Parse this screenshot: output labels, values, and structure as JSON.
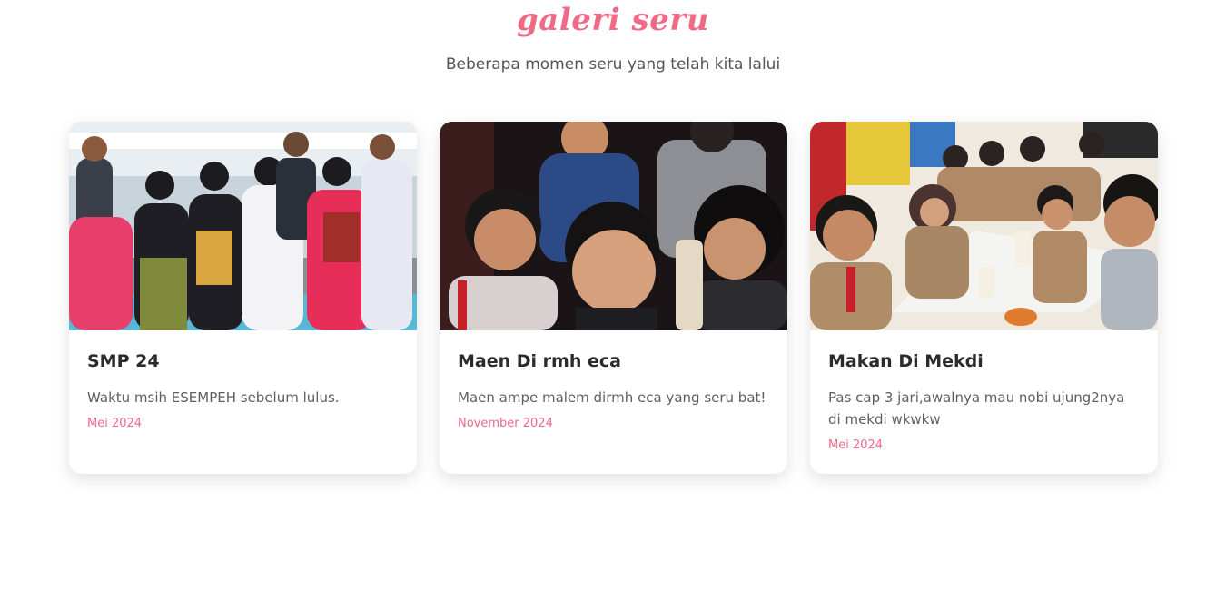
{
  "header": {
    "title": "galeri seru",
    "subtitle": "Beberapa momen seru yang telah kita lalui"
  },
  "colors": {
    "accent": "#f06a86",
    "title_text": "#2b2b2b",
    "body_text": "#5f5f5f"
  },
  "cards": [
    {
      "title": "SMP 24",
      "description": "Waktu msih ESEMPEH sebelum lulus.",
      "date": "Mei 2024"
    },
    {
      "title": "Maen Di rmh eca",
      "description": "Maen ampe malem dirmh eca yang seru bat!",
      "date": "November 2024"
    },
    {
      "title": "Makan Di Mekdi",
      "description": "Pas cap 3 jari,awalnya mau nobi ujung2nya di mekdi wkwkw",
      "date": "Mei 2024"
    }
  ]
}
